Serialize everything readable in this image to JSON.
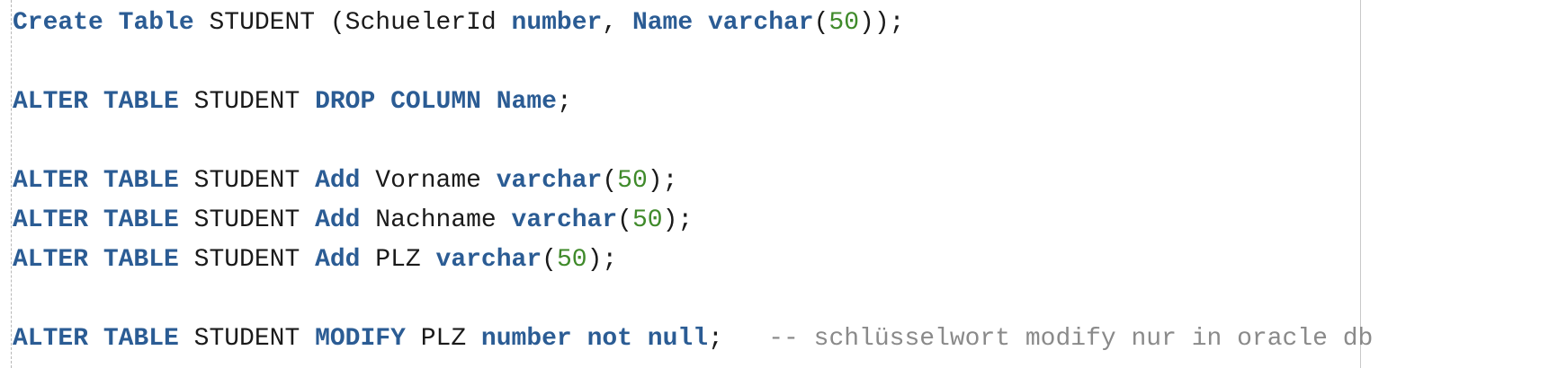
{
  "editor": {
    "theme": {
      "keyword": "#2b5c94",
      "number": "#3f8a2a",
      "comment": "#8a8a8a",
      "text": "#1a1a1a",
      "background": "#ffffff"
    },
    "lines": [
      [
        {
          "t": "kw",
          "v": "Create"
        },
        {
          "t": "plain",
          "v": " "
        },
        {
          "t": "kw",
          "v": "Table"
        },
        {
          "t": "plain",
          "v": " STUDENT (SchuelerId "
        },
        {
          "t": "kw",
          "v": "number"
        },
        {
          "t": "plain",
          "v": ", "
        },
        {
          "t": "kw",
          "v": "Name"
        },
        {
          "t": "plain",
          "v": " "
        },
        {
          "t": "kw",
          "v": "varchar"
        },
        {
          "t": "plain",
          "v": "("
        },
        {
          "t": "num",
          "v": "50"
        },
        {
          "t": "plain",
          "v": "));"
        }
      ],
      [],
      [
        {
          "t": "kw",
          "v": "ALTER"
        },
        {
          "t": "plain",
          "v": " "
        },
        {
          "t": "kw",
          "v": "TABLE"
        },
        {
          "t": "plain",
          "v": " STUDENT "
        },
        {
          "t": "kw",
          "v": "DROP"
        },
        {
          "t": "plain",
          "v": " "
        },
        {
          "t": "kw",
          "v": "COLUMN"
        },
        {
          "t": "plain",
          "v": " "
        },
        {
          "t": "kw",
          "v": "Name"
        },
        {
          "t": "plain",
          "v": ";"
        }
      ],
      [],
      [
        {
          "t": "kw",
          "v": "ALTER"
        },
        {
          "t": "plain",
          "v": " "
        },
        {
          "t": "kw",
          "v": "TABLE"
        },
        {
          "t": "plain",
          "v": " STUDENT "
        },
        {
          "t": "kw",
          "v": "Add"
        },
        {
          "t": "plain",
          "v": " Vorname "
        },
        {
          "t": "kw",
          "v": "varchar"
        },
        {
          "t": "plain",
          "v": "("
        },
        {
          "t": "num",
          "v": "50"
        },
        {
          "t": "plain",
          "v": ");"
        }
      ],
      [
        {
          "t": "kw",
          "v": "ALTER"
        },
        {
          "t": "plain",
          "v": " "
        },
        {
          "t": "kw",
          "v": "TABLE"
        },
        {
          "t": "plain",
          "v": " STUDENT "
        },
        {
          "t": "kw",
          "v": "Add"
        },
        {
          "t": "plain",
          "v": " Nachname "
        },
        {
          "t": "kw",
          "v": "varchar"
        },
        {
          "t": "plain",
          "v": "("
        },
        {
          "t": "num",
          "v": "50"
        },
        {
          "t": "plain",
          "v": ");"
        }
      ],
      [
        {
          "t": "kw",
          "v": "ALTER"
        },
        {
          "t": "plain",
          "v": " "
        },
        {
          "t": "kw",
          "v": "TABLE"
        },
        {
          "t": "plain",
          "v": " STUDENT "
        },
        {
          "t": "kw",
          "v": "Add"
        },
        {
          "t": "plain",
          "v": " PLZ "
        },
        {
          "t": "kw",
          "v": "varchar"
        },
        {
          "t": "plain",
          "v": "("
        },
        {
          "t": "num",
          "v": "50"
        },
        {
          "t": "plain",
          "v": ");"
        }
      ],
      [],
      [
        {
          "t": "kw",
          "v": "ALTER"
        },
        {
          "t": "plain",
          "v": " "
        },
        {
          "t": "kw",
          "v": "TABLE"
        },
        {
          "t": "plain",
          "v": " STUDENT "
        },
        {
          "t": "kw",
          "v": "MODIFY"
        },
        {
          "t": "plain",
          "v": " PLZ "
        },
        {
          "t": "kw",
          "v": "number"
        },
        {
          "t": "plain",
          "v": " "
        },
        {
          "t": "kw",
          "v": "not"
        },
        {
          "t": "plain",
          "v": " "
        },
        {
          "t": "kw",
          "v": "null"
        },
        {
          "t": "plain",
          "v": ";   "
        },
        {
          "t": "comment",
          "v": "-- schlüsselwort modify nur in oracle db"
        }
      ]
    ]
  }
}
